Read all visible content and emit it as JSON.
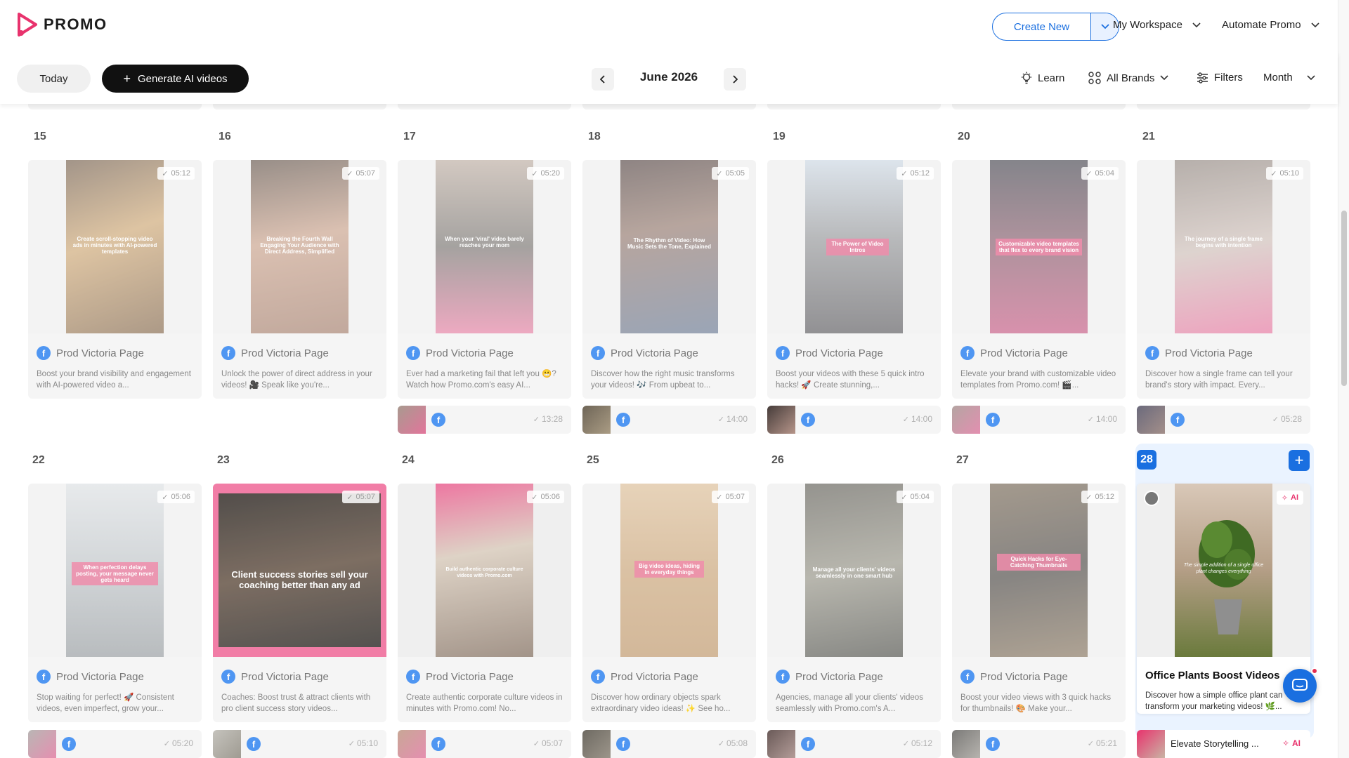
{
  "header": {
    "brand": "PROMO",
    "create_new": "Create New",
    "workspace": "My Workspace",
    "automate": "Automate Promo"
  },
  "toolbar": {
    "today": "Today",
    "generate": "Generate AI videos",
    "month_title": "June 2026",
    "learn": "Learn",
    "brands": "All Brands",
    "filters": "Filters",
    "view": "Month"
  },
  "colors": {
    "accent": "#1a6fe0",
    "brand_pink": "#e8336d",
    "facebook": "#1877f2",
    "ai_badge": "#e8336d"
  },
  "week1": {
    "days": [
      "15",
      "16",
      "17",
      "18",
      "19",
      "20",
      "21"
    ],
    "cards": [
      {
        "page": "Prod Victoria Page",
        "duration": "05:12",
        "desc": "Boost your brand visibility and engagement with AI-powered video a...",
        "caption": "Create scroll-stopping video ads in minutes with AI-powered templates"
      },
      {
        "page": "Prod Victoria Page",
        "duration": "05:07",
        "desc": "Unlock the power of direct address in your videos! 🎥 Speak like you're...",
        "caption": "Breaking the Fourth Wall Engaging Your Audience with Direct Address, Simplified"
      },
      {
        "page": "Prod Victoria Page",
        "duration": "05:20",
        "desc": "Ever had a marketing fail that left you 😬? Watch how Promo.com's easy AI...",
        "caption": "When your 'viral' video barely reaches your mom"
      },
      {
        "page": "Prod Victoria Page",
        "duration": "05:05",
        "desc": "Discover how the right music transforms your videos! 🎶 From upbeat to...",
        "caption": "The Rhythm of Video: How Music Sets the Tone, Explained"
      },
      {
        "page": "Prod Victoria Page",
        "duration": "05:12",
        "desc": "Boost your videos with these 5 quick intro hacks! 🚀 Create stunning,...",
        "caption": "The Power of Video Intros"
      },
      {
        "page": "Prod Victoria Page",
        "duration": "05:04",
        "desc": "Elevate your brand with customizable video templates from Promo.com! 🎬...",
        "caption": "Customizable video templates that flex to every brand vision"
      },
      {
        "page": "Prod Victoria Page",
        "duration": "05:10",
        "desc": "Discover how a single frame can tell your brand's story with impact. Every...",
        "caption": "The journey of a single frame begins with intention"
      }
    ],
    "scheduled": [
      null,
      null,
      {
        "time": "13:28"
      },
      {
        "time": "14:00"
      },
      {
        "time": "14:00"
      },
      {
        "time": "14:00"
      },
      {
        "time": "05:28"
      }
    ]
  },
  "week2": {
    "days": [
      "22",
      "23",
      "24",
      "25",
      "26",
      "27",
      "28"
    ],
    "cards": [
      {
        "page": "Prod Victoria Page",
        "duration": "05:06",
        "desc": "Stop waiting for perfect! 🚀 Consistent videos, even imperfect, grow your...",
        "caption": "When perfection delays posting, your message never gets heard"
      },
      {
        "page": "Prod Victoria Page",
        "duration": "05:07",
        "desc": "Coaches: Boost trust & attract clients with pro client success story videos...",
        "caption": "Client success stories sell your coaching better than any ad"
      },
      {
        "page": "Prod Victoria Page",
        "duration": "05:06",
        "desc": "Create authentic corporate culture videos in minutes with Promo.com! No...",
        "caption": "Build authentic corporate culture videos with Promo.com"
      },
      {
        "page": "Prod Victoria Page",
        "duration": "05:07",
        "desc": "Discover how ordinary objects spark extraordinary video ideas! ✨ See ho...",
        "caption": "Big video ideas, hiding in everyday things"
      },
      {
        "page": "Prod Victoria Page",
        "duration": "05:04",
        "desc": "Agencies, manage all your clients' videos seamlessly with Promo.com's A...",
        "caption": "Manage all your clients' videos seamlessly in one smart hub"
      },
      {
        "page": "Prod Victoria Page",
        "duration": "05:12",
        "desc": "Boost your video views with 3 quick hacks for thumbnails! 🎨 Make your...",
        "caption": "Quick Hacks for Eye-Catching Thumbnails"
      }
    ],
    "scheduled": [
      {
        "time": "05:20"
      },
      {
        "time": "05:10"
      },
      {
        "time": "05:07"
      },
      {
        "time": "05:08"
      },
      {
        "time": "05:12"
      },
      {
        "time": "05:21"
      }
    ],
    "today_card": {
      "ai_badge": "AI",
      "title": "Office Plants Boost Videos",
      "desc": "Discover how a simple office plant can transform your marketing videos! 🌿...",
      "caption": "The simple addition of a single office plant changes everything",
      "next_title": "Elevate Storytelling ...",
      "next_badge": "AI"
    }
  }
}
